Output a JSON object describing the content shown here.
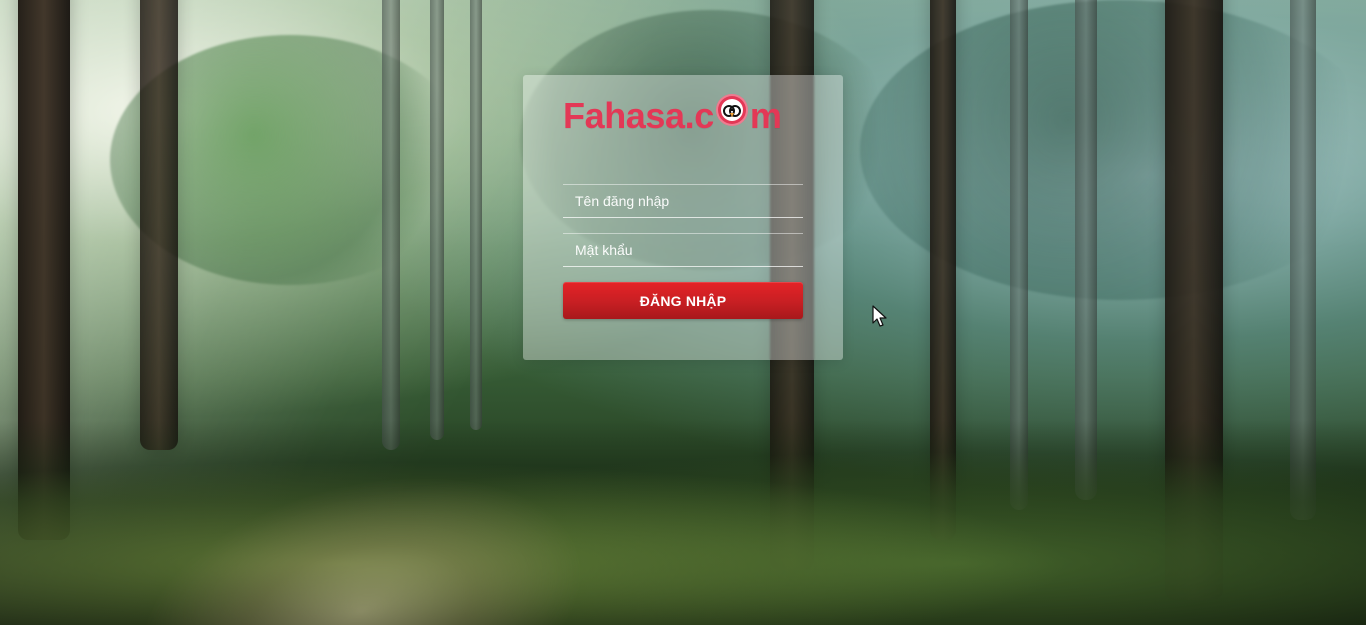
{
  "brand": {
    "name_before_o": "Fahasa.c",
    "name_after_o": "m",
    "primary_color": "#e33856",
    "mascot": "owl-with-glasses-icon"
  },
  "login_form": {
    "username_placeholder": "Tên đăng nhập",
    "password_placeholder": "Mật khẩu",
    "submit_label": "ĐĂNG NHẬP",
    "button_color": "#d52126"
  },
  "background": {
    "theme": "forest-sunrays"
  },
  "cursor": {
    "icon": "arrow-pointer-icon"
  }
}
